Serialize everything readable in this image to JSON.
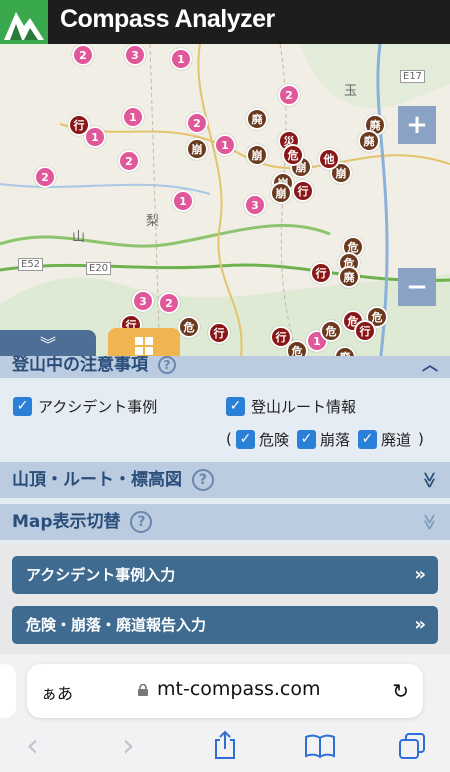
{
  "app": {
    "title": "Compass Analyzer"
  },
  "map": {
    "labels": [
      "山",
      "梨",
      "E52",
      "E20",
      "E17",
      "玉"
    ],
    "zoom_in": "+",
    "zoom_out": "−",
    "markers": {
      "pink": "pink-marker",
      "brown": "brown-marker",
      "red": "red-marker"
    }
  },
  "panel": {
    "notice_section": {
      "title": "登山中の注意事項",
      "chevron": "︿"
    },
    "checkboxes": {
      "accident": "アクシデント事例",
      "route": "登山ルート情報",
      "open_paren": "(",
      "danger": "危険",
      "collapse": "崩落",
      "abandoned": "廃道",
      "close_paren": ")"
    },
    "summit_section": {
      "title": "山頂・ルート・標高図",
      "chevron": "≫"
    },
    "map_section": {
      "title": "Map表示切替",
      "chevron": "≫"
    },
    "buttons": {
      "accident_input": "アクシデント事例入力",
      "report_input": "危険・崩落・廃道報告入力",
      "arrow": "»"
    }
  },
  "browser": {
    "text_size": "ぁあ",
    "url": "mt-compass.com",
    "reload": "↻",
    "toolbar": {
      "back": "‹",
      "forward": "›",
      "share": "share",
      "bookmarks": "book",
      "tabs": "tabs"
    }
  },
  "colors": {
    "pink": "#e0589a",
    "brown": "#6b3a1e",
    "red": "#8a1717",
    "header": "#1d1d1b",
    "button": "#3f6b91"
  }
}
